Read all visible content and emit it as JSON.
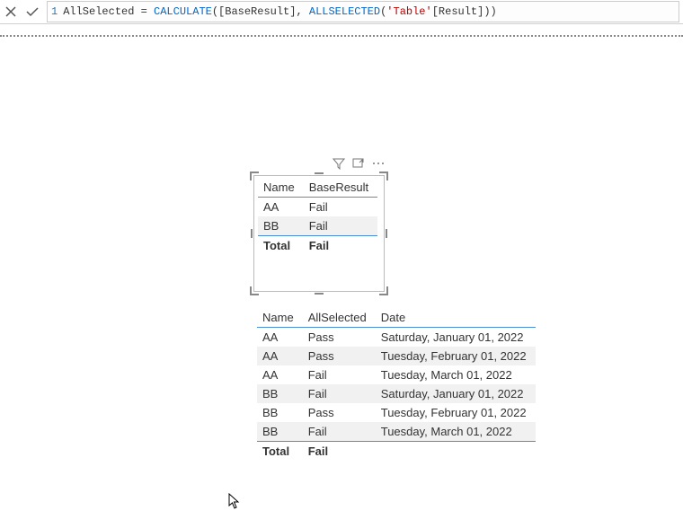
{
  "formula": {
    "line_number": "1",
    "parts": [
      {
        "k": "plain",
        "t": "AllSelected = "
      },
      {
        "k": "func",
        "t": "CALCULATE"
      },
      {
        "k": "plain",
        "t": "([BaseResult], "
      },
      {
        "k": "func",
        "t": "ALLSELECTED"
      },
      {
        "k": "plain",
        "t": "("
      },
      {
        "k": "str",
        "t": "'Table'"
      },
      {
        "k": "plain",
        "t": "[Result]))"
      }
    ]
  },
  "visual1": {
    "columns": [
      "Name",
      "BaseResult"
    ],
    "rows": [
      {
        "name": "AA",
        "result": "Fail"
      },
      {
        "name": "BB",
        "result": "Fail"
      }
    ],
    "total": {
      "label": "Total",
      "value": "Fail"
    }
  },
  "visual2": {
    "columns": [
      "Name",
      "AllSelected",
      "Date"
    ],
    "rows": [
      {
        "name": "AA",
        "sel": "Pass",
        "date": "Saturday, January 01, 2022"
      },
      {
        "name": "AA",
        "sel": "Pass",
        "date": "Tuesday, February 01, 2022"
      },
      {
        "name": "AA",
        "sel": "Fail",
        "date": "Tuesday, March 01, 2022"
      },
      {
        "name": "BB",
        "sel": "Fail",
        "date": "Saturday, January 01, 2022"
      },
      {
        "name": "BB",
        "sel": "Pass",
        "date": "Tuesday, February 01, 2022"
      },
      {
        "name": "BB",
        "sel": "Fail",
        "date": "Tuesday, March 01, 2022"
      }
    ],
    "total": {
      "label": "Total",
      "value": "Fail"
    }
  }
}
